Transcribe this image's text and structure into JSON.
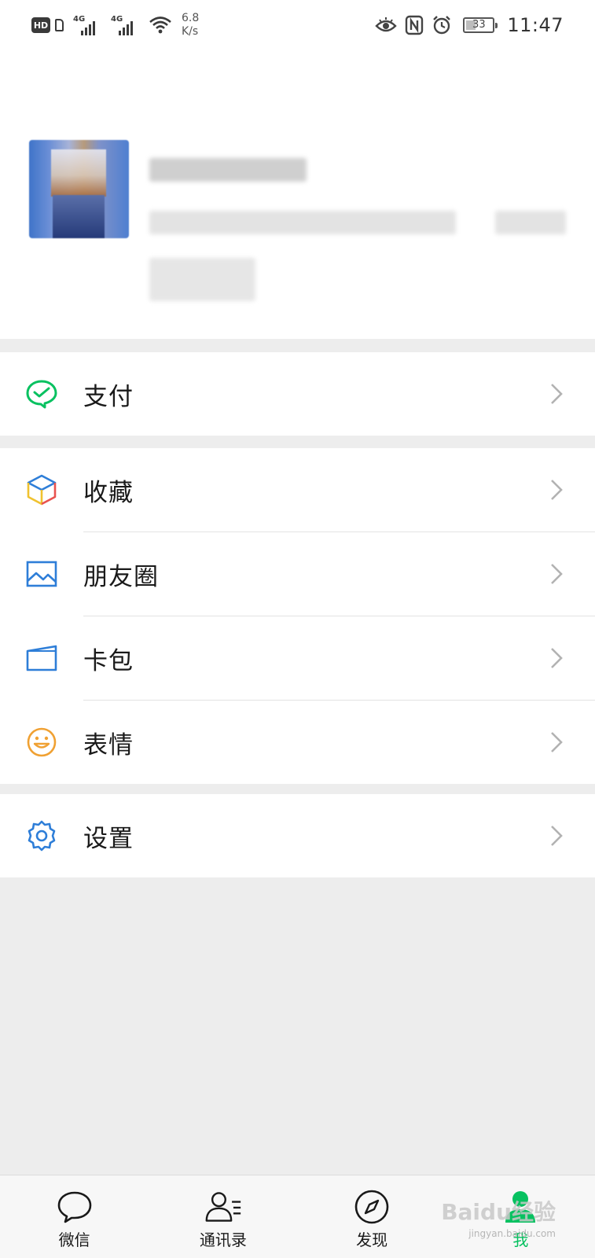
{
  "status_bar": {
    "hd_label": "HD",
    "sim1_net": "4G",
    "sim2_net": "4G",
    "net_speed_value": "6.8",
    "net_speed_unit": "K/s",
    "battery_level": "33",
    "time": "11:47",
    "icons": [
      "hd-icon",
      "sim-icon",
      "signal-icon",
      "signal-icon",
      "wifi-icon",
      "eye-comfort-icon",
      "nfc-icon",
      "alarm-icon",
      "battery-icon"
    ]
  },
  "profile": {
    "avatar_icon": "avatar",
    "redacted": true
  },
  "menu": {
    "pay": {
      "label": "支付",
      "icon": "pay-icon",
      "color": "#07c160"
    },
    "items": [
      {
        "label": "收藏",
        "icon": "favorites-cube-icon"
      },
      {
        "label": "朋友圈",
        "icon": "moments-picture-icon",
        "color": "#2e7ed8"
      },
      {
        "label": "卡包",
        "icon": "card-wallet-icon",
        "color": "#2e7ed8"
      },
      {
        "label": "表情",
        "icon": "sticker-smile-icon",
        "color": "#f0a133"
      }
    ],
    "settings": {
      "label": "设置",
      "icon": "gear-icon",
      "color": "#2e7ed8"
    }
  },
  "tab_bar": {
    "tabs": [
      {
        "label": "微信",
        "icon": "chat-bubble-icon",
        "active": false
      },
      {
        "label": "通讯录",
        "icon": "contacts-icon",
        "active": false
      },
      {
        "label": "发现",
        "icon": "compass-icon",
        "active": false
      },
      {
        "label": "我",
        "icon": "me-person-icon",
        "active": true
      }
    ],
    "active_color": "#07c160"
  },
  "watermark": {
    "text": "Baidu经验",
    "subtext": "jingyan.baidu.com"
  }
}
